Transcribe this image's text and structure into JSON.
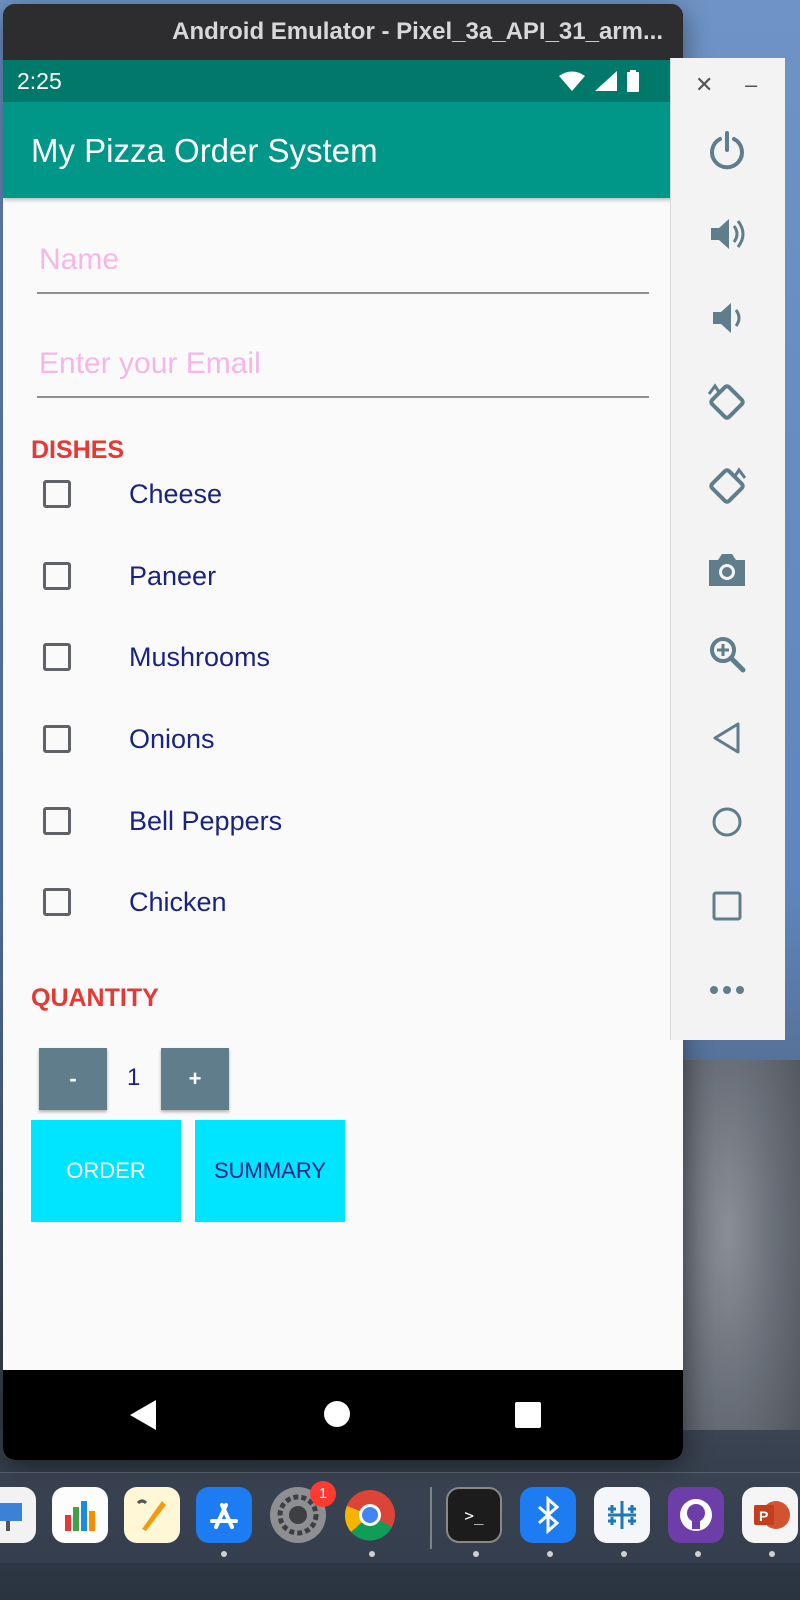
{
  "window": {
    "title": "Android Emulator - Pixel_3a_API_31_arm..."
  },
  "status_bar": {
    "time": "2:25"
  },
  "app_bar": {
    "title": "My Pizza Order System"
  },
  "form": {
    "name_placeholder": "Name",
    "email_placeholder": "Enter your Email"
  },
  "dishes": {
    "heading": "DISHES",
    "items": [
      {
        "label": "Cheese",
        "checked": false
      },
      {
        "label": "Paneer",
        "checked": false
      },
      {
        "label": "Mushrooms",
        "checked": false
      },
      {
        "label": "Onions",
        "checked": false
      },
      {
        "label": "Bell Peppers",
        "checked": false
      },
      {
        "label": "Chicken",
        "checked": false
      }
    ]
  },
  "quantity": {
    "heading": "QUANTITY",
    "decrement_label": "-",
    "value": "1",
    "increment_label": "+"
  },
  "actions": {
    "order_label": "ORDER",
    "summary_label": "SUMMARY"
  },
  "dock": {
    "badge_count": "1"
  },
  "colors": {
    "status_bar": "#00796b",
    "app_bar": "#009688",
    "section_heading": "#e53935",
    "dish_text": "#1a237e",
    "placeholder": "#f6b6e8",
    "qty_button": "#607d8b",
    "action_button": "#00e5ff"
  }
}
